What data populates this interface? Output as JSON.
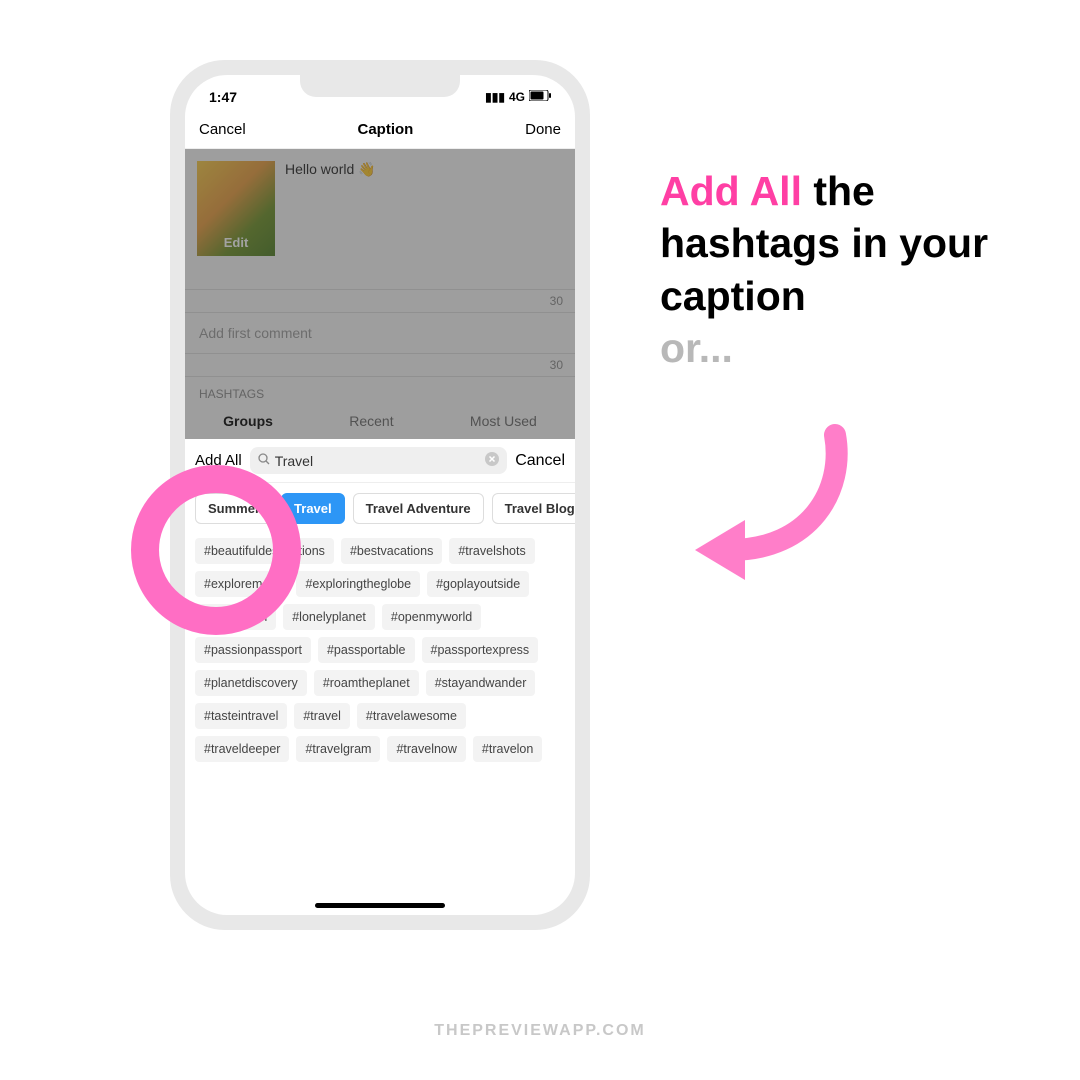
{
  "status": {
    "time": "1:47",
    "network": "4G"
  },
  "nav": {
    "left": "Cancel",
    "title": "Caption",
    "right": "Done"
  },
  "caption": {
    "text": "Hello world 👋",
    "edit": "Edit"
  },
  "counter1": "30",
  "first_comment": "Add first comment",
  "counter2": "30",
  "hashtags_label": "HASHTAGS",
  "tabs": {
    "groups": "Groups",
    "recent": "Recent",
    "most": "Most Used"
  },
  "search": {
    "addall": "Add All",
    "value": "Travel",
    "cancel": "Cancel"
  },
  "pills": [
    "Summer",
    "Travel",
    "Travel Adventure",
    "Travel Blogger"
  ],
  "hashtags": [
    "#beautifuldestinations",
    "#bestvacations",
    "#travelshots",
    "#exploremore",
    "#exploringtheglobe",
    "#goplayoutside",
    "#ilovetravel",
    "#lonelyplanet",
    "#openmyworld",
    "#passionpassport",
    "#passportable",
    "#passportexpress",
    "#planetdiscovery",
    "#roamtheplanet",
    "#stayandwander",
    "#tasteintravel",
    "#travel",
    "#travelawesome",
    "#traveldeeper",
    "#travelgram",
    "#travelnow",
    "#travelon"
  ],
  "headline": {
    "part1": "Add All",
    "part2": " the hashtags in your caption",
    "part3": "or..."
  },
  "footer": "THEPREVIEWAPP.COM"
}
